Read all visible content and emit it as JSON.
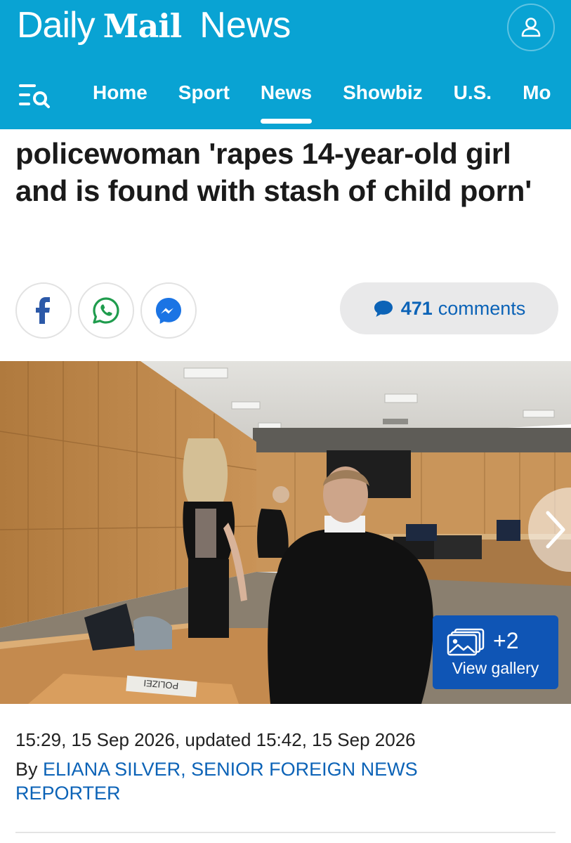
{
  "header": {
    "brand_daily": "Daily",
    "brand_mail": "Mail",
    "brand_section": "News",
    "account_icon": "user-icon",
    "menu_icon": "menu-search-icon",
    "bg_color": "#09a3d3"
  },
  "nav": {
    "items": [
      {
        "label": "Home"
      },
      {
        "label": "Sport"
      },
      {
        "label": "News",
        "active": true
      },
      {
        "label": "Showbiz"
      },
      {
        "label": "U.S."
      },
      {
        "label": "Mo"
      }
    ]
  },
  "article": {
    "headline": "policewoman 'rapes 14-year-old girl and is found with stash of child porn'",
    "comments_count": "471",
    "comments_label": "comments",
    "share": {
      "facebook": "facebook-icon",
      "whatsapp": "whatsapp-icon",
      "messenger": "messenger-icon"
    },
    "gallery": {
      "count": "+2",
      "label": "View gallery"
    },
    "image_sign_text": "POLIZEI",
    "timestamp": "15:29, 15 Sep 2026, updated 15:42, 15 Sep 2026",
    "byline_prefix": "By",
    "author": "ELIANA SILVER, SENIOR FOREIGN NEWS REPORTER"
  },
  "colors": {
    "accent": "#09a3d3",
    "link": "#0c63b7",
    "gallery_button": "#0f55b5"
  }
}
